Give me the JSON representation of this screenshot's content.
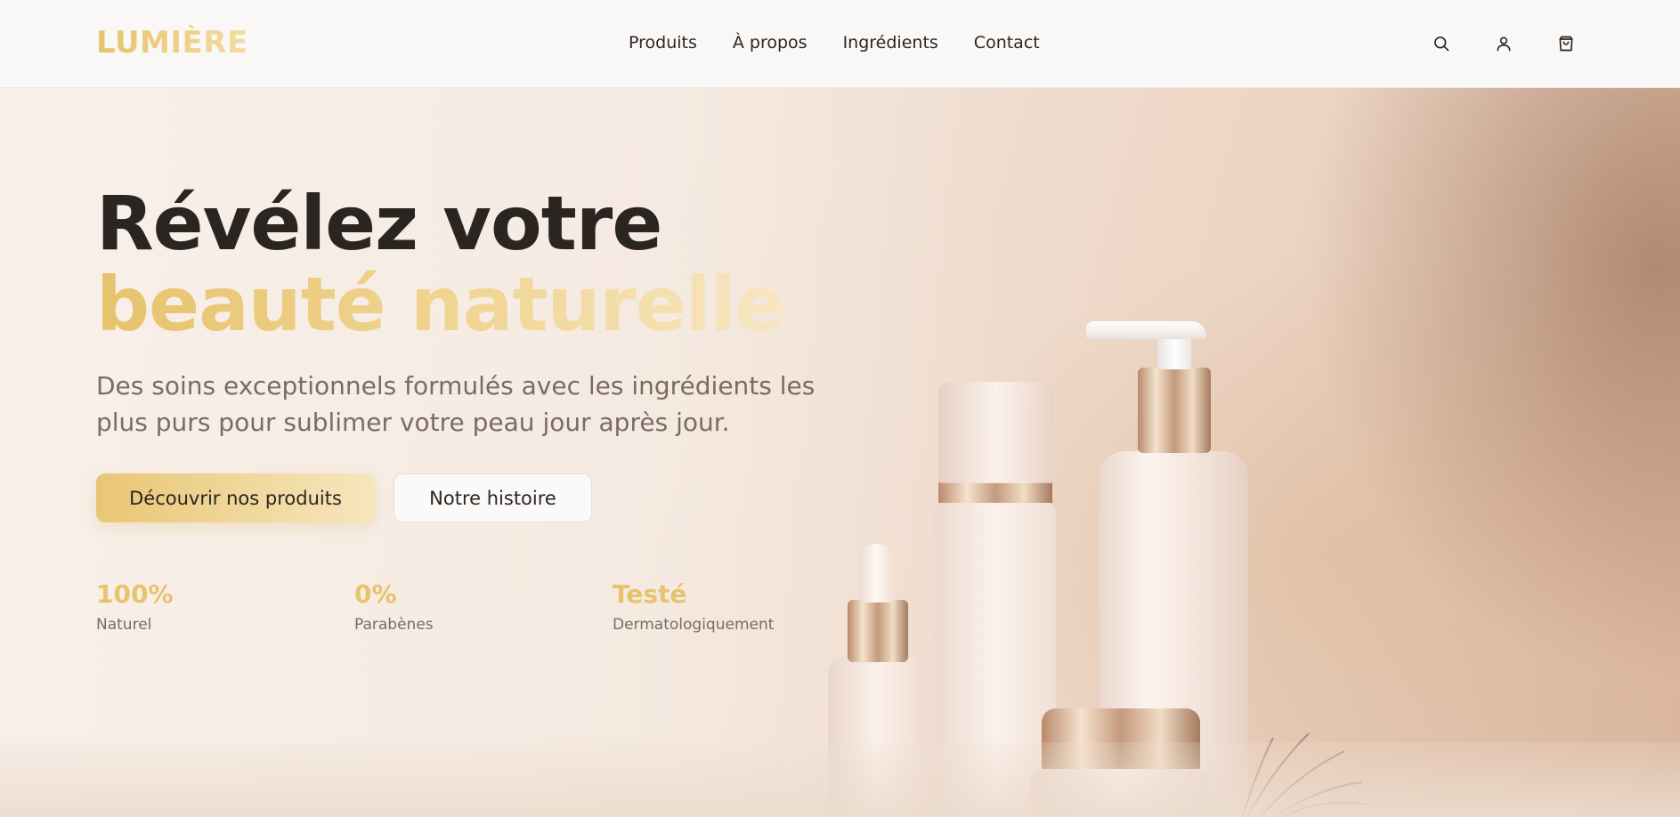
{
  "brand": {
    "logo": "LUMIÈRE"
  },
  "nav": {
    "items": [
      {
        "label": "Produits"
      },
      {
        "label": "À propos"
      },
      {
        "label": "Ingrédients"
      },
      {
        "label": "Contact"
      }
    ],
    "icons": [
      "search-icon",
      "user-icon",
      "shopping-bag-icon"
    ]
  },
  "hero": {
    "title_line1": "Révélez votre",
    "title_line2": "beauté naturelle",
    "subtitle": "Des soins exceptionnels formulés avec les ingrédients les plus purs pour sublimer votre peau jour après jour.",
    "primary_cta": "Découvrir nos produits",
    "secondary_cta": "Notre histoire",
    "stats": [
      {
        "value": "100%",
        "label": "Naturel"
      },
      {
        "value": "0%",
        "label": "Parabènes"
      },
      {
        "value": "Testé",
        "label": "Dermatologiquement"
      }
    ]
  },
  "colors": {
    "accent": "#e6c36c",
    "accent_light": "#f7e6bd",
    "text_dark": "#2b2522",
    "text_muted": "#7a6c64",
    "nav_bg": "#faf8f6"
  }
}
